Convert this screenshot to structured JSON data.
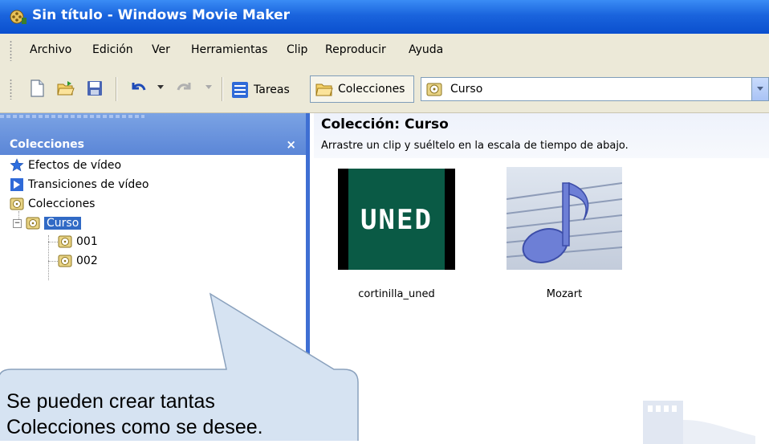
{
  "window": {
    "title": "Sin título - Windows Movie Maker"
  },
  "menu": [
    "Archivo",
    "Edición",
    "Ver",
    "Herramientas",
    "Clip",
    "Reproducir",
    "Ayuda"
  ],
  "toolbar": {
    "tareas_label": "Tareas",
    "colecciones_label": "Colecciones",
    "combo_value": "Curso"
  },
  "left_pane": {
    "title": "Colecciones",
    "close": "×",
    "tree": [
      {
        "label": "Efectos de vídeo",
        "icon": "star-icon"
      },
      {
        "label": "Transiciones de vídeo",
        "icon": "transition-icon"
      },
      {
        "label": "Colecciones",
        "icon": "collection-icon"
      },
      {
        "label": "Curso",
        "icon": "collection-icon",
        "selected": true
      },
      {
        "label": "001",
        "icon": "collection-icon"
      },
      {
        "label": "002",
        "icon": "collection-icon"
      }
    ]
  },
  "main": {
    "title": "Colección: Curso",
    "subtitle": "Arrastre un clip y suéltelo en la escala de tiempo de abajo.",
    "clips": [
      {
        "name": "cortinilla_uned",
        "thumb_text": "UNED"
      },
      {
        "name": "Mozart",
        "thumb": "music-note"
      }
    ]
  },
  "callout": {
    "line1": "Se pueden crear tantas",
    "line2": "Colecciones como se desee."
  }
}
